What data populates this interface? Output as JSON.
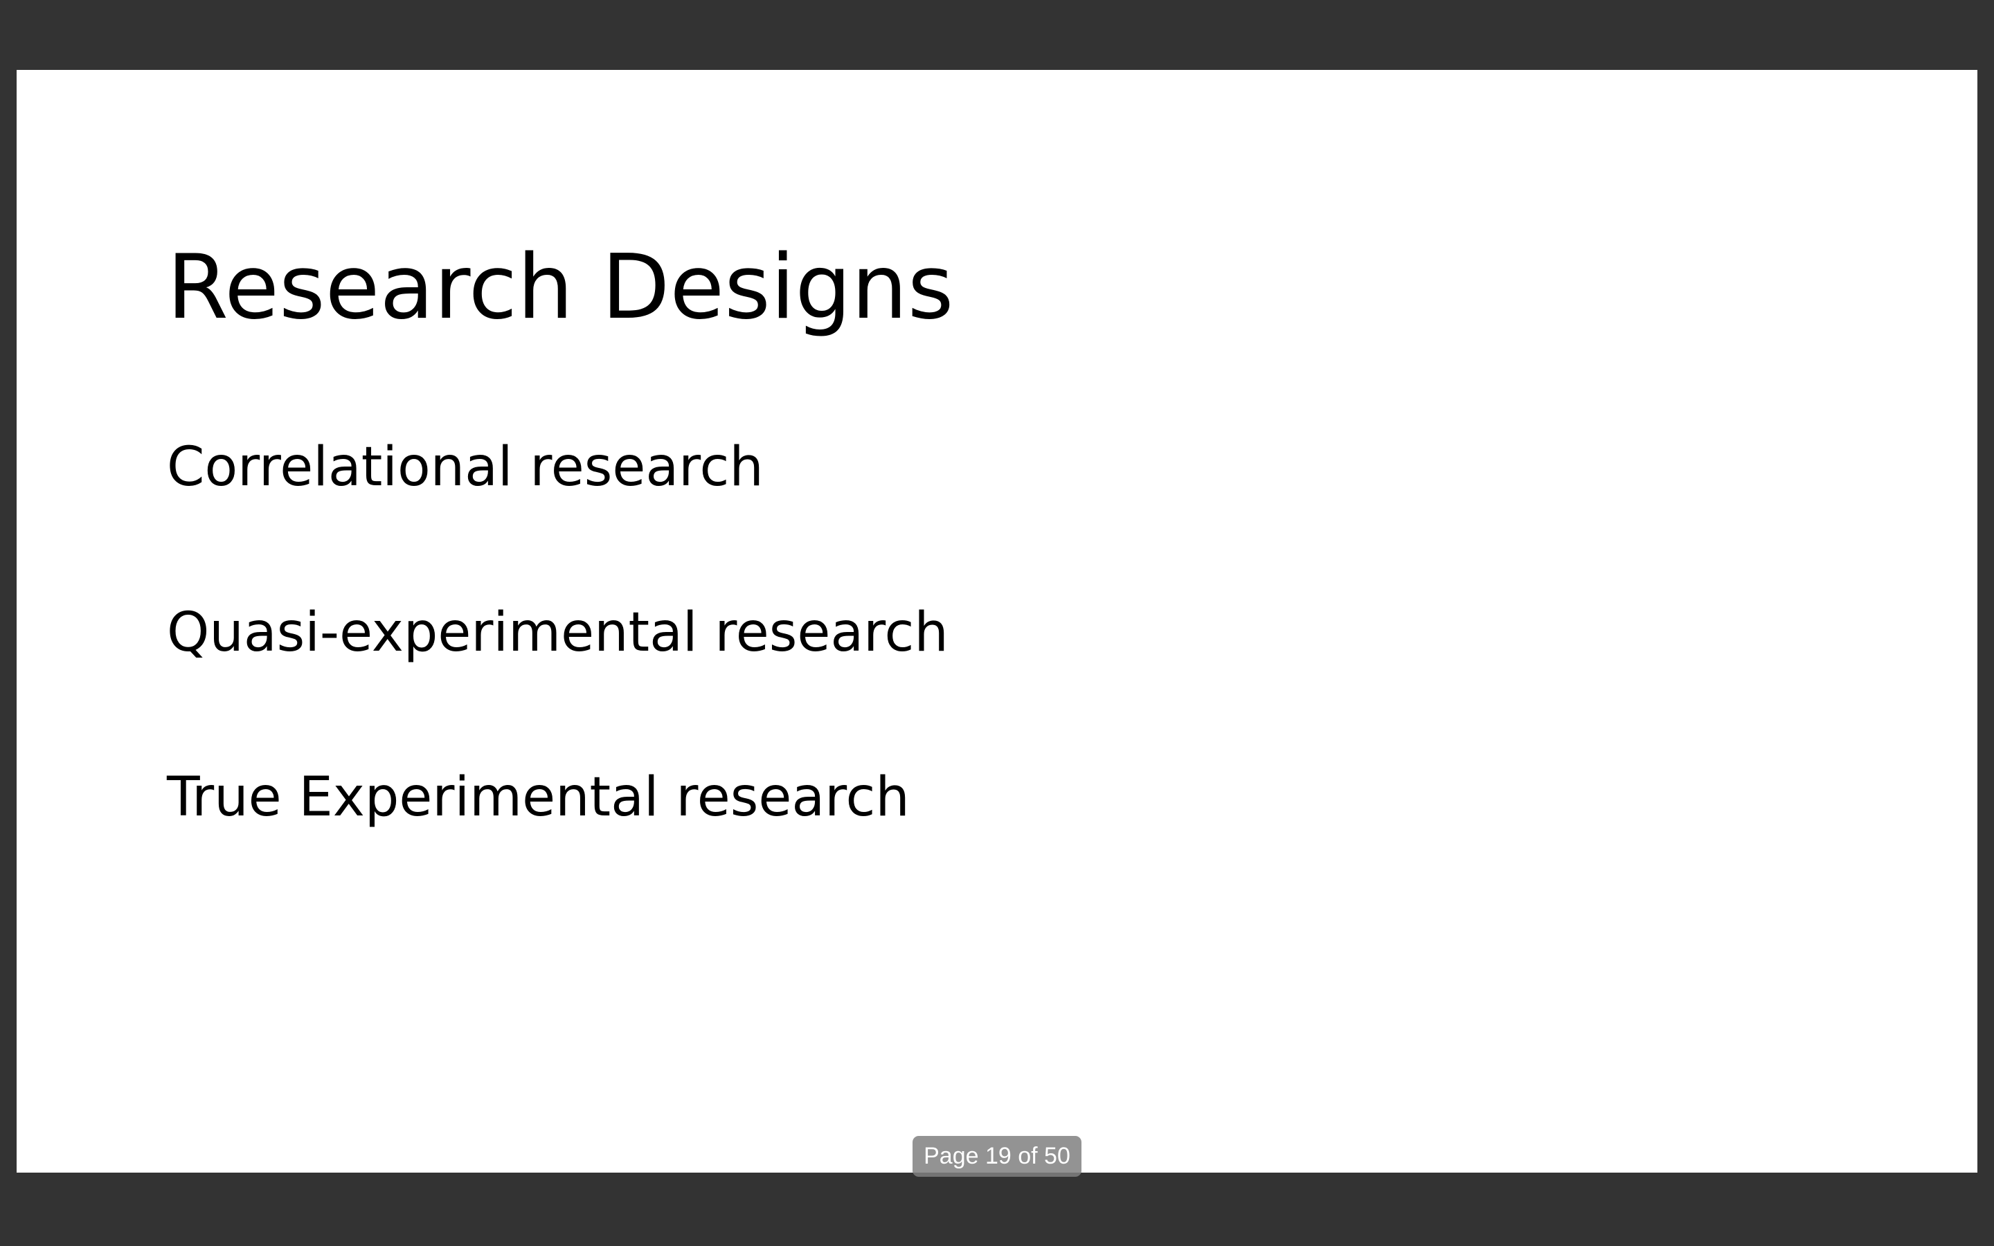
{
  "slide": {
    "title": "Research Designs",
    "bullets": [
      "Correlational research",
      "Quasi-experimental research",
      "True Experimental research"
    ]
  },
  "viewer": {
    "page_indicator": "Page 19 of 50",
    "background_color": "#333333",
    "slide_color": "#ffffff"
  }
}
